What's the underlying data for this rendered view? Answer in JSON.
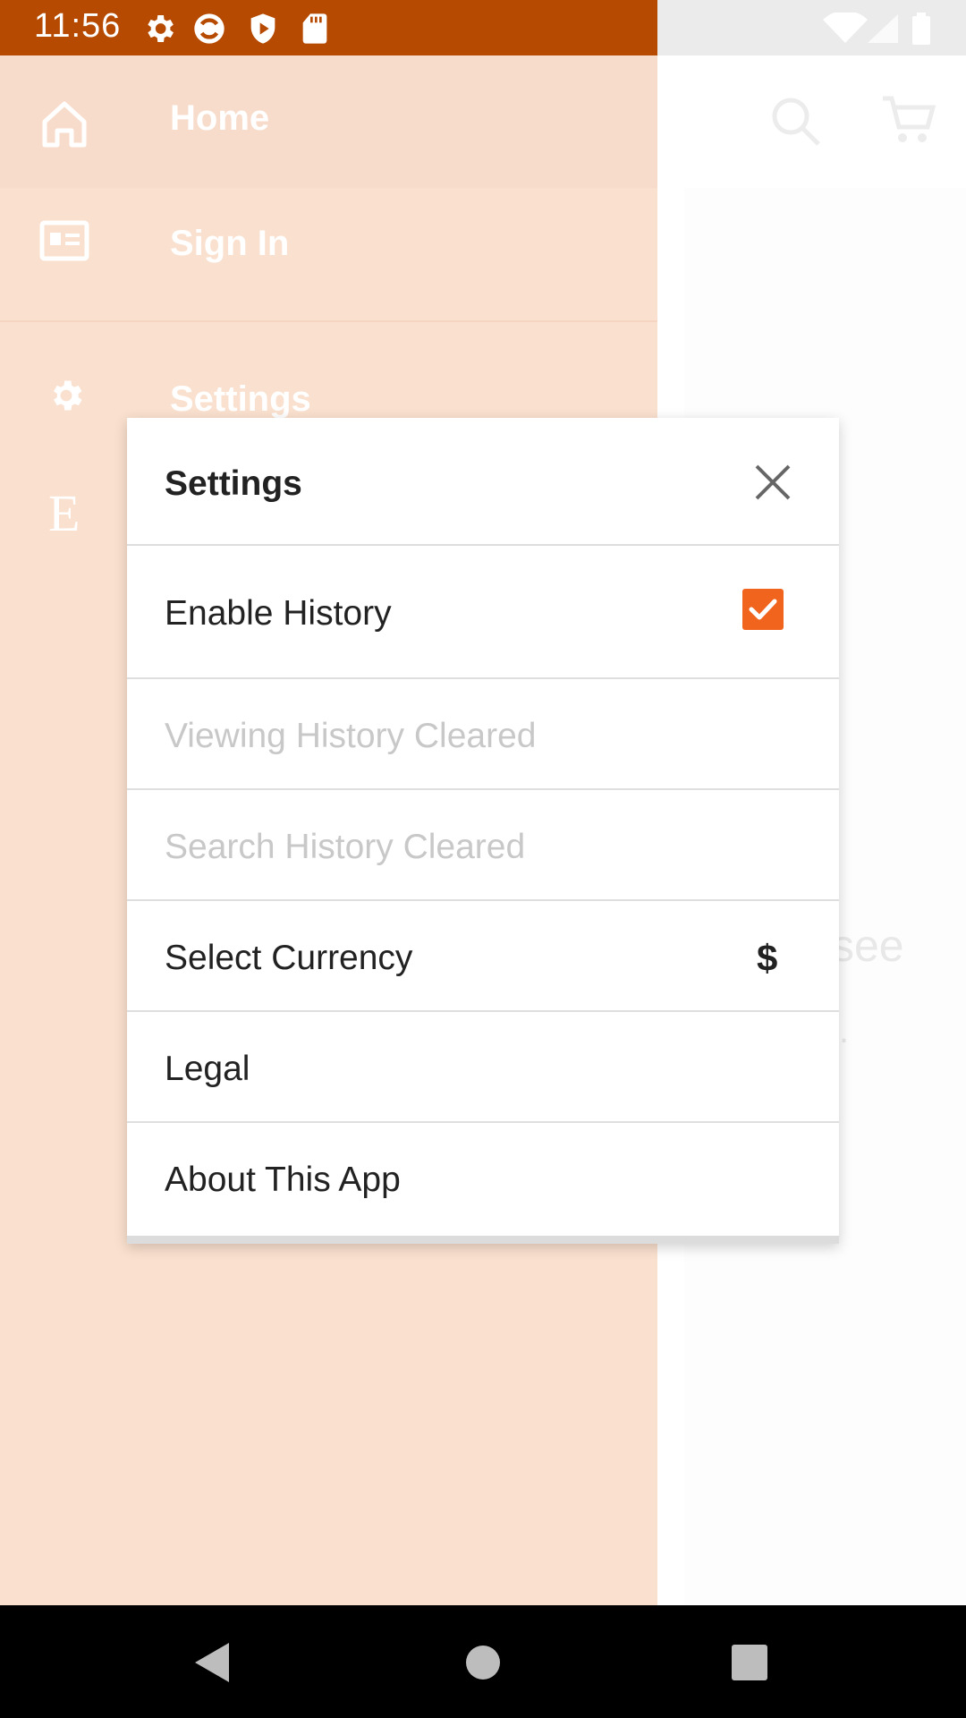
{
  "status_bar": {
    "time": "11:56",
    "colors": {
      "bar": "#b54a00",
      "right": "#ebebeb"
    },
    "icons": [
      "gear-icon",
      "sync-icon",
      "play-protect-icon",
      "sd-card-icon",
      "wifi-icon",
      "signal-icon",
      "battery-icon"
    ]
  },
  "drawer": {
    "items": [
      {
        "label": "Home",
        "icon": "home-icon"
      },
      {
        "label": "Sign In",
        "icon": "id-card-icon"
      },
      {
        "label": "Settings",
        "icon": "gear-icon"
      }
    ],
    "brand_letter": "E",
    "color": "#fae0ce"
  },
  "background_app": {
    "partial_text": "see",
    "partial_mark": ".",
    "icons": [
      "search-icon",
      "cart-icon"
    ]
  },
  "dialog": {
    "title": "Settings",
    "close_icon": "close-icon",
    "rows": [
      {
        "label": "Enable History",
        "checked": true
      },
      {
        "label": "Viewing History Cleared",
        "disabled": true
      },
      {
        "label": "Search History Cleared",
        "disabled": true
      },
      {
        "label": "Select Currency",
        "value": "$"
      },
      {
        "label": "Legal"
      },
      {
        "label": "About This App"
      }
    ],
    "accent": "#f1641e"
  },
  "nav_bar": {
    "icons": [
      "back-icon",
      "home-circle-icon",
      "recents-icon"
    ]
  }
}
